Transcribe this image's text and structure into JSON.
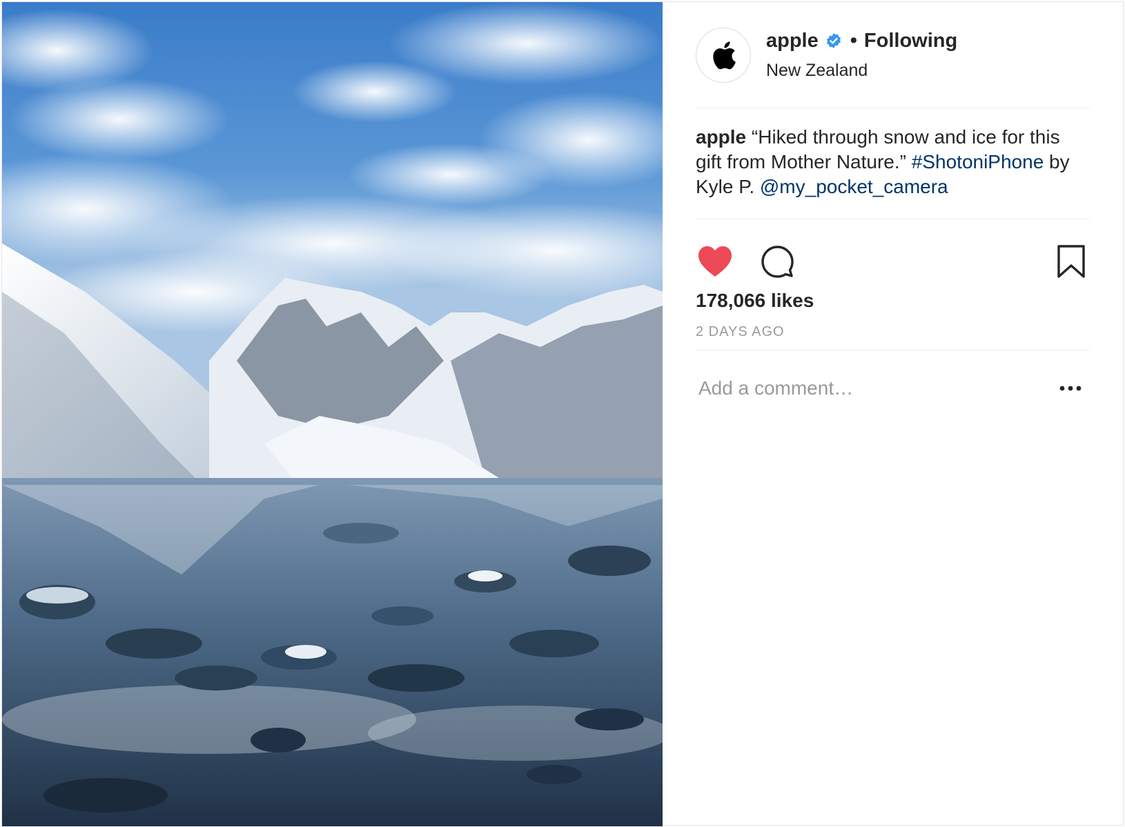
{
  "post": {
    "username": "apple",
    "separator": "•",
    "follow_status": "Following",
    "location": "New Zealand",
    "caption": {
      "username": "apple",
      "text": " “Hiked through snow and ice for this gift from Mother Nature.” ",
      "hashtag": "#ShotoniPhone",
      "by_text": " by Kyle P. ",
      "mention": "@my_pocket_camera"
    },
    "likes": "178,066 likes",
    "timestamp": "2 DAYS AGO",
    "comment_placeholder": "Add a comment…"
  },
  "colors": {
    "like_red": "#ed4956",
    "verified_blue": "#3897f0",
    "link_blue": "#003569",
    "muted_gray": "#999999"
  },
  "icons": {
    "avatar": "apple-logo-icon",
    "verified": "verified-badge-icon",
    "like": "heart-icon",
    "comment": "comment-icon",
    "save": "bookmark-icon",
    "options": "more-options-icon"
  }
}
